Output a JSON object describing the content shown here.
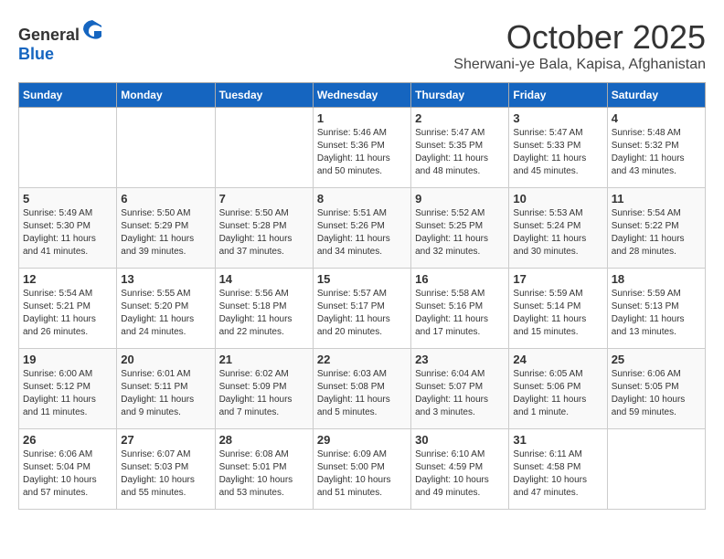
{
  "header": {
    "logo_general": "General",
    "logo_blue": "Blue",
    "month": "October 2025",
    "location": "Sherwani-ye Bala, Kapisa, Afghanistan"
  },
  "days_of_week": [
    "Sunday",
    "Monday",
    "Tuesday",
    "Wednesday",
    "Thursday",
    "Friday",
    "Saturday"
  ],
  "weeks": [
    [
      {
        "day": "",
        "sunrise": "",
        "sunset": "",
        "daylight": ""
      },
      {
        "day": "",
        "sunrise": "",
        "sunset": "",
        "daylight": ""
      },
      {
        "day": "",
        "sunrise": "",
        "sunset": "",
        "daylight": ""
      },
      {
        "day": "1",
        "sunrise": "Sunrise: 5:46 AM",
        "sunset": "Sunset: 5:36 PM",
        "daylight": "Daylight: 11 hours and 50 minutes."
      },
      {
        "day": "2",
        "sunrise": "Sunrise: 5:47 AM",
        "sunset": "Sunset: 5:35 PM",
        "daylight": "Daylight: 11 hours and 48 minutes."
      },
      {
        "day": "3",
        "sunrise": "Sunrise: 5:47 AM",
        "sunset": "Sunset: 5:33 PM",
        "daylight": "Daylight: 11 hours and 45 minutes."
      },
      {
        "day": "4",
        "sunrise": "Sunrise: 5:48 AM",
        "sunset": "Sunset: 5:32 PM",
        "daylight": "Daylight: 11 hours and 43 minutes."
      }
    ],
    [
      {
        "day": "5",
        "sunrise": "Sunrise: 5:49 AM",
        "sunset": "Sunset: 5:30 PM",
        "daylight": "Daylight: 11 hours and 41 minutes."
      },
      {
        "day": "6",
        "sunrise": "Sunrise: 5:50 AM",
        "sunset": "Sunset: 5:29 PM",
        "daylight": "Daylight: 11 hours and 39 minutes."
      },
      {
        "day": "7",
        "sunrise": "Sunrise: 5:50 AM",
        "sunset": "Sunset: 5:28 PM",
        "daylight": "Daylight: 11 hours and 37 minutes."
      },
      {
        "day": "8",
        "sunrise": "Sunrise: 5:51 AM",
        "sunset": "Sunset: 5:26 PM",
        "daylight": "Daylight: 11 hours and 34 minutes."
      },
      {
        "day": "9",
        "sunrise": "Sunrise: 5:52 AM",
        "sunset": "Sunset: 5:25 PM",
        "daylight": "Daylight: 11 hours and 32 minutes."
      },
      {
        "day": "10",
        "sunrise": "Sunrise: 5:53 AM",
        "sunset": "Sunset: 5:24 PM",
        "daylight": "Daylight: 11 hours and 30 minutes."
      },
      {
        "day": "11",
        "sunrise": "Sunrise: 5:54 AM",
        "sunset": "Sunset: 5:22 PM",
        "daylight": "Daylight: 11 hours and 28 minutes."
      }
    ],
    [
      {
        "day": "12",
        "sunrise": "Sunrise: 5:54 AM",
        "sunset": "Sunset: 5:21 PM",
        "daylight": "Daylight: 11 hours and 26 minutes."
      },
      {
        "day": "13",
        "sunrise": "Sunrise: 5:55 AM",
        "sunset": "Sunset: 5:20 PM",
        "daylight": "Daylight: 11 hours and 24 minutes."
      },
      {
        "day": "14",
        "sunrise": "Sunrise: 5:56 AM",
        "sunset": "Sunset: 5:18 PM",
        "daylight": "Daylight: 11 hours and 22 minutes."
      },
      {
        "day": "15",
        "sunrise": "Sunrise: 5:57 AM",
        "sunset": "Sunset: 5:17 PM",
        "daylight": "Daylight: 11 hours and 20 minutes."
      },
      {
        "day": "16",
        "sunrise": "Sunrise: 5:58 AM",
        "sunset": "Sunset: 5:16 PM",
        "daylight": "Daylight: 11 hours and 17 minutes."
      },
      {
        "day": "17",
        "sunrise": "Sunrise: 5:59 AM",
        "sunset": "Sunset: 5:14 PM",
        "daylight": "Daylight: 11 hours and 15 minutes."
      },
      {
        "day": "18",
        "sunrise": "Sunrise: 5:59 AM",
        "sunset": "Sunset: 5:13 PM",
        "daylight": "Daylight: 11 hours and 13 minutes."
      }
    ],
    [
      {
        "day": "19",
        "sunrise": "Sunrise: 6:00 AM",
        "sunset": "Sunset: 5:12 PM",
        "daylight": "Daylight: 11 hours and 11 minutes."
      },
      {
        "day": "20",
        "sunrise": "Sunrise: 6:01 AM",
        "sunset": "Sunset: 5:11 PM",
        "daylight": "Daylight: 11 hours and 9 minutes."
      },
      {
        "day": "21",
        "sunrise": "Sunrise: 6:02 AM",
        "sunset": "Sunset: 5:09 PM",
        "daylight": "Daylight: 11 hours and 7 minutes."
      },
      {
        "day": "22",
        "sunrise": "Sunrise: 6:03 AM",
        "sunset": "Sunset: 5:08 PM",
        "daylight": "Daylight: 11 hours and 5 minutes."
      },
      {
        "day": "23",
        "sunrise": "Sunrise: 6:04 AM",
        "sunset": "Sunset: 5:07 PM",
        "daylight": "Daylight: 11 hours and 3 minutes."
      },
      {
        "day": "24",
        "sunrise": "Sunrise: 6:05 AM",
        "sunset": "Sunset: 5:06 PM",
        "daylight": "Daylight: 11 hours and 1 minute."
      },
      {
        "day": "25",
        "sunrise": "Sunrise: 6:06 AM",
        "sunset": "Sunset: 5:05 PM",
        "daylight": "Daylight: 10 hours and 59 minutes."
      }
    ],
    [
      {
        "day": "26",
        "sunrise": "Sunrise: 6:06 AM",
        "sunset": "Sunset: 5:04 PM",
        "daylight": "Daylight: 10 hours and 57 minutes."
      },
      {
        "day": "27",
        "sunrise": "Sunrise: 6:07 AM",
        "sunset": "Sunset: 5:03 PM",
        "daylight": "Daylight: 10 hours and 55 minutes."
      },
      {
        "day": "28",
        "sunrise": "Sunrise: 6:08 AM",
        "sunset": "Sunset: 5:01 PM",
        "daylight": "Daylight: 10 hours and 53 minutes."
      },
      {
        "day": "29",
        "sunrise": "Sunrise: 6:09 AM",
        "sunset": "Sunset: 5:00 PM",
        "daylight": "Daylight: 10 hours and 51 minutes."
      },
      {
        "day": "30",
        "sunrise": "Sunrise: 6:10 AM",
        "sunset": "Sunset: 4:59 PM",
        "daylight": "Daylight: 10 hours and 49 minutes."
      },
      {
        "day": "31",
        "sunrise": "Sunrise: 6:11 AM",
        "sunset": "Sunset: 4:58 PM",
        "daylight": "Daylight: 10 hours and 47 minutes."
      },
      {
        "day": "",
        "sunrise": "",
        "sunset": "",
        "daylight": ""
      }
    ]
  ]
}
